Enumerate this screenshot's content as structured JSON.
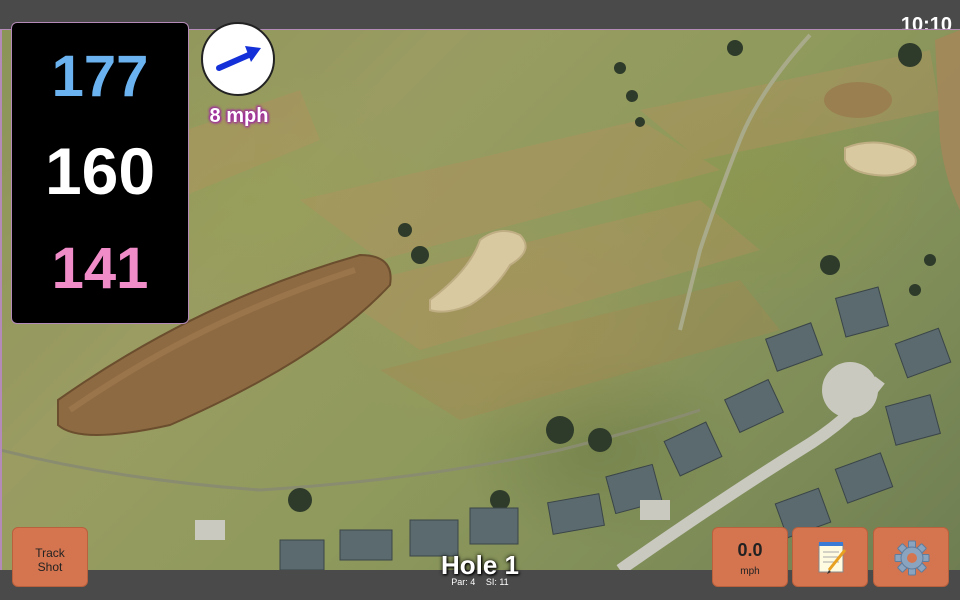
{
  "status": {
    "time": "10:10"
  },
  "yardage": {
    "back": "177",
    "middle": "160",
    "front": "141"
  },
  "wind": {
    "speed_label": "8 mph",
    "icon": "wind-arrow-icon"
  },
  "hole": {
    "title": "Hole 1",
    "par": "Par: 4",
    "si": "SI: 11"
  },
  "buttons": {
    "track_shot_line1": "Track",
    "track_shot_line2": "Shot",
    "speed_value": "0.0",
    "speed_unit": "mph",
    "notes_icon": "notepad-icon",
    "settings_icon": "gear-icon"
  },
  "colors": {
    "button": "#d47550",
    "back_yardage": "#6bb3f0",
    "middle_yardage": "#ffffff",
    "front_yardage": "#f08cc8"
  }
}
